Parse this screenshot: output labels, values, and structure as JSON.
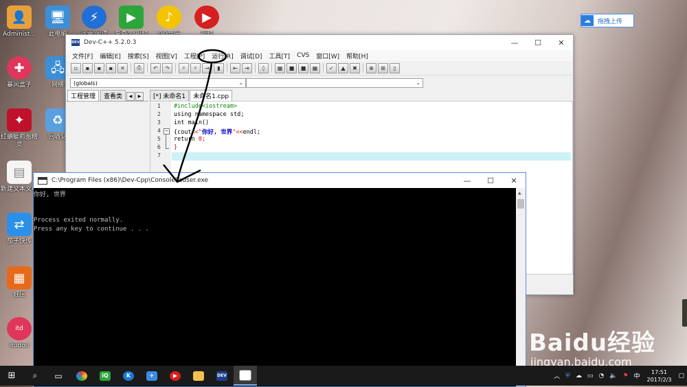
{
  "desktop": {
    "icons": [
      {
        "label": "Administ...",
        "color": "#e8a13a"
      },
      {
        "label": "此电脑",
        "color": "#3c8fd6"
      },
      {
        "label": "迅雷 阅读",
        "color": "#1f6fd6"
      },
      {
        "label": "爱奇艺 视频",
        "color": "#2ca53a"
      },
      {
        "label": "QQ音乐",
        "color": "#f4c400"
      },
      {
        "label": "视频",
        "color": "#d6201f"
      },
      {
        "label": "暴风盒子",
        "color": "#e0365c"
      },
      {
        "label": "网络",
        "color": "#3c8fd6"
      },
      {
        "label": "红蜻蜓抓图精灵",
        "color": "#c0102a"
      },
      {
        "label": "回收站",
        "color": "#5aa0e0"
      },
      {
        "label": "新建文本文档",
        "color": "#f5f5f5"
      },
      {
        "label": "茄子快传",
        "color": "#2a90e8"
      },
      {
        "label": "好压",
        "color": "#e66a1a"
      },
      {
        "label": "itudou",
        "color": "#e0365c"
      }
    ]
  },
  "baidu_button": {
    "label": "拖拽上传"
  },
  "watermark": {
    "brand": "Baidu经验",
    "url": "jingyan.baidu.com"
  },
  "devcpp": {
    "title": "Dev-C++ 5.2.0.3",
    "menu": [
      "文件[F]",
      "编辑[E]",
      "搜索[S]",
      "视图[V]",
      "工程[P]",
      "运行[R]",
      "调试[D]",
      "工具[T]",
      "CVS",
      "窗口[W]",
      "帮助[H]"
    ],
    "combo1": "(globals)",
    "combo2": "",
    "left_tabs": [
      "工程管理",
      "查看类"
    ],
    "editor_tabs": [
      "[*] 未命名1",
      "未命名1.cpp"
    ],
    "line_numbers": [
      "1",
      "2",
      "3",
      "4",
      "5",
      "6",
      "7"
    ],
    "code": {
      "l1": "#include<iostream>",
      "l2": "using namespace std;",
      "l3": "int main()",
      "l4a": "{cout",
      "l4b": "<<\"",
      "l4c": "你好, 世界",
      "l4d": "\"<<",
      "l4e": "endl;",
      "l5a": "return ",
      "l5b": "0;",
      "l6": "}"
    }
  },
  "console": {
    "title": "C:\\Program Files (x86)\\Dev-Cpp\\ConsolePauser.exe",
    "lines": [
      "你好, 世界",
      "",
      "",
      "Process exited normally.",
      "Press any key to continue . . ."
    ]
  },
  "taskbar": {
    "time": "17:51",
    "date": "2017/2/3",
    "ime": "中"
  }
}
